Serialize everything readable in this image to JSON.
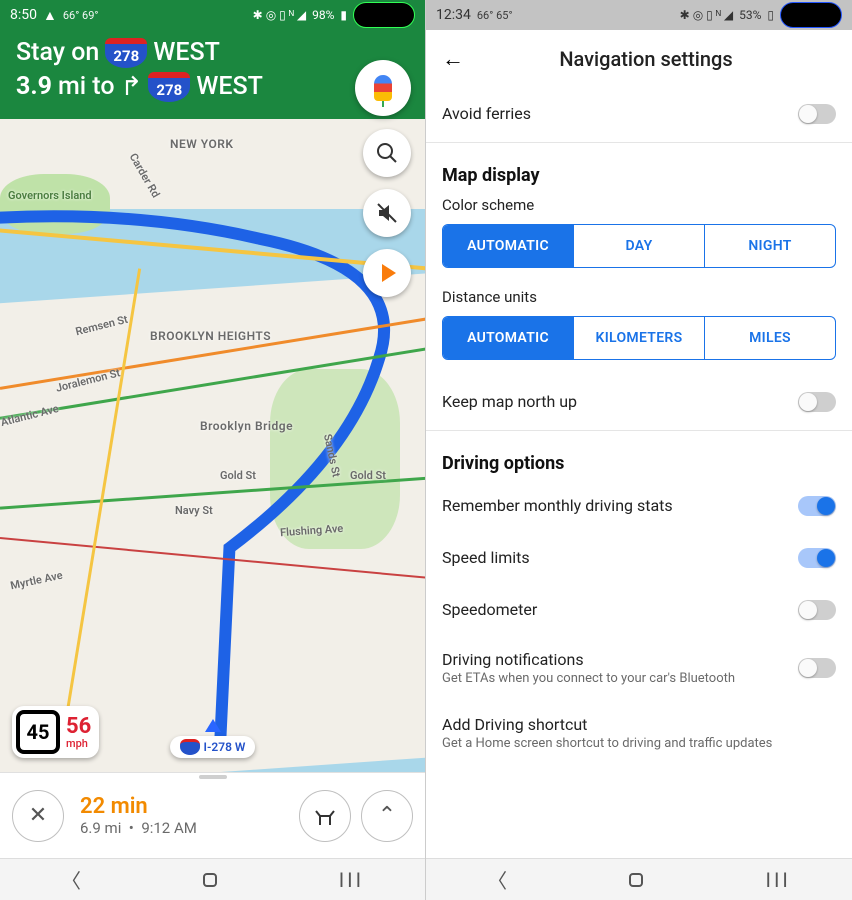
{
  "left": {
    "status": {
      "time": "8:50",
      "weather": "66° 69°",
      "battery": "98%"
    },
    "directions": {
      "line1_pre": "Stay on",
      "shield1": "278",
      "line1_post": "WEST",
      "distance": "3.9",
      "unit": "mi to",
      "shield2": "278",
      "line2_post": "WEST"
    },
    "map_labels": {
      "ny": "NEW YORK",
      "gov": "Governors Island",
      "bkhts": "BROOKLYN HEIGHTS",
      "bridge": "Brooklyn Bridge",
      "gold": "Gold St",
      "gold2": "Gold St",
      "navy": "Navy St",
      "sands": "Sands St",
      "flushing": "Flushing Ave",
      "myrtle": "Myrtle Ave",
      "atlantic": "Atlantic Ave",
      "joralemon": "Joralemon St",
      "remsen": "Remsen St",
      "carder": "Carder Rd"
    },
    "speed": {
      "limit": "45",
      "current": "56",
      "unit": "mph"
    },
    "route_badge": "I-278 W",
    "trip": {
      "remaining": "22 min",
      "dist": "6.9 mi",
      "sep": "•",
      "arrive": "9:12 AM"
    }
  },
  "right": {
    "status": {
      "time": "12:34",
      "weather": "66° 65°",
      "battery": "53%"
    },
    "title": "Navigation settings",
    "rows": {
      "avoid_ferries": "Avoid ferries",
      "map_display": "Map display",
      "color_scheme": "Color scheme",
      "color_options": [
        "AUTOMATIC",
        "DAY",
        "NIGHT"
      ],
      "distance_units": "Distance units",
      "distance_options": [
        "AUTOMATIC",
        "KILOMETERS",
        "MILES"
      ],
      "keep_north": "Keep map north up",
      "driving_options": "Driving options",
      "remember": "Remember monthly driving stats",
      "speed_limits": "Speed limits",
      "speedometer": "Speedometer",
      "driving_notif": "Driving notifications",
      "driving_notif_sub": "Get ETAs when you connect to your car's Bluetooth",
      "add_shortcut": "Add Driving shortcut",
      "add_shortcut_sub": "Get a Home screen shortcut to driving and traffic updates"
    }
  }
}
